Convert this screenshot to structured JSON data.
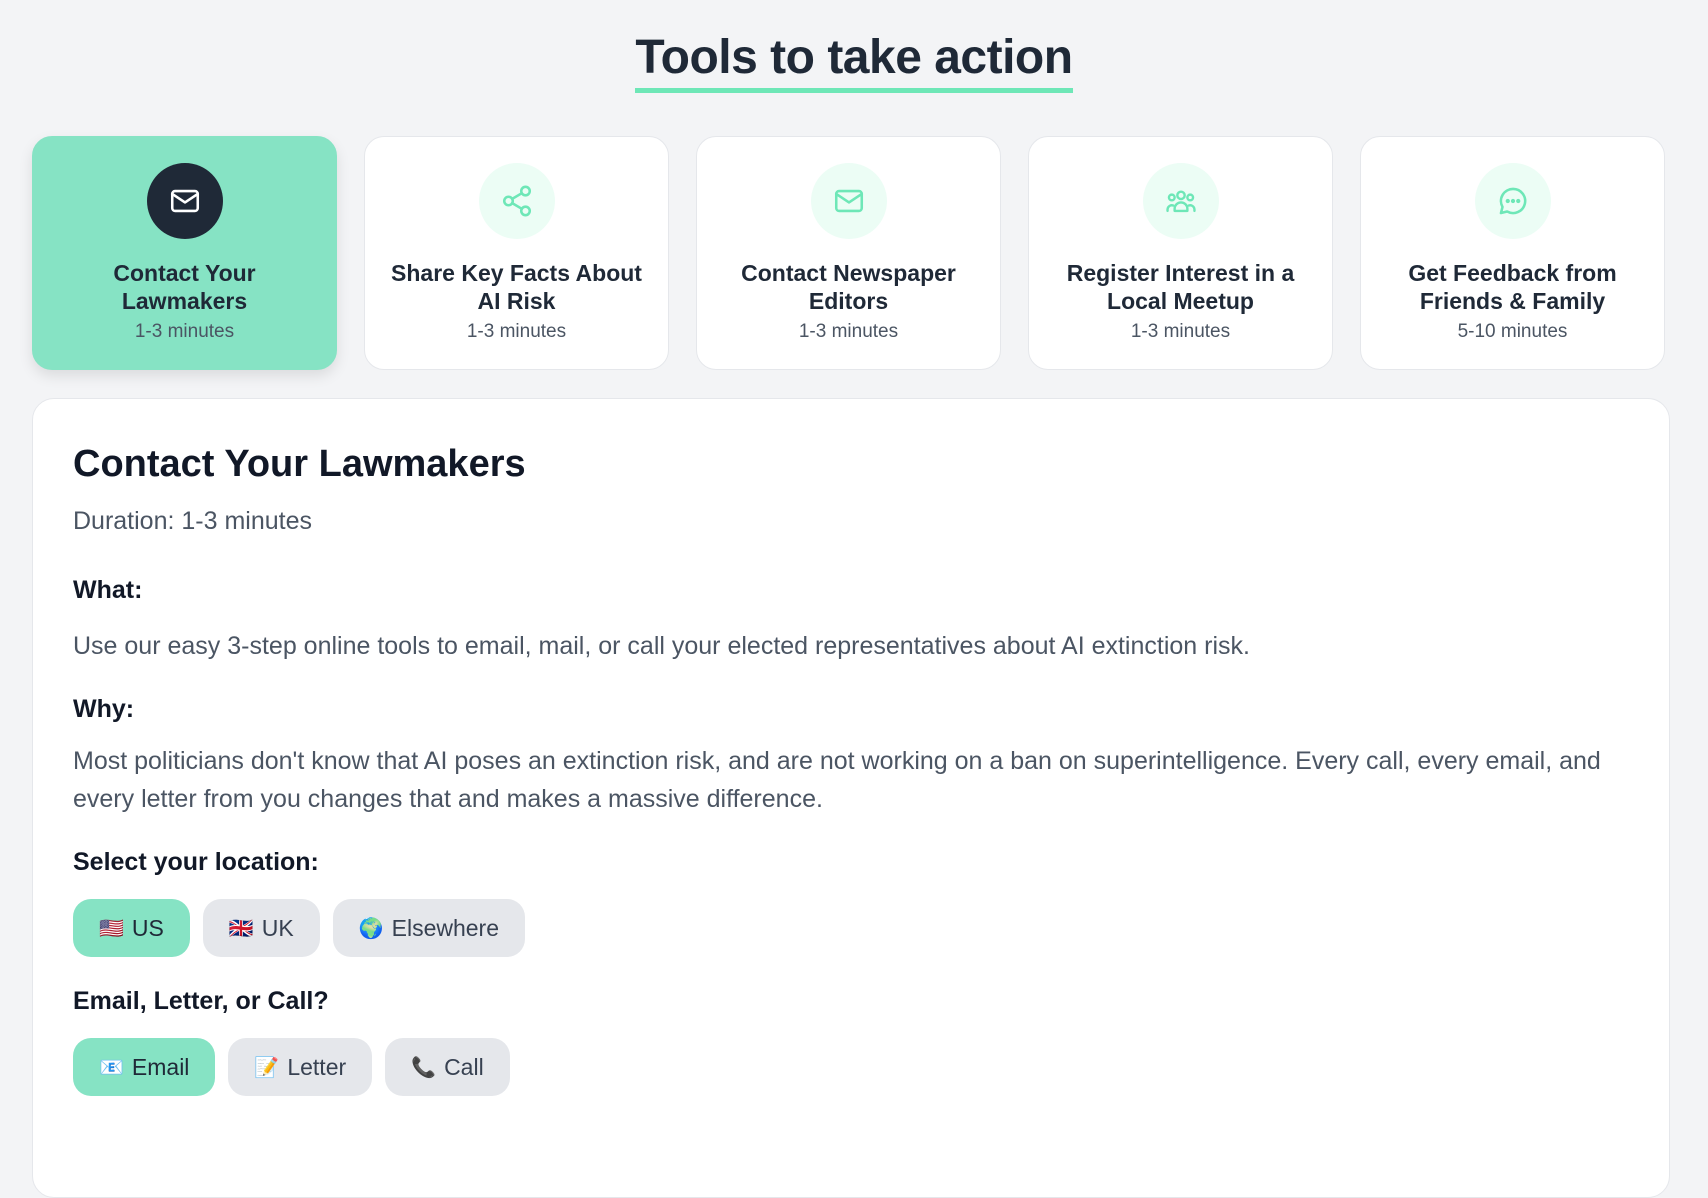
{
  "header": {
    "title": "Tools to take action"
  },
  "cards": [
    {
      "title": "Contact Your Lawmakers",
      "time": "1-3 minutes",
      "icon": "mail-icon"
    },
    {
      "title": "Share Key Facts About AI Risk",
      "time": "1-3 minutes",
      "icon": "share-icon"
    },
    {
      "title": "Contact Newspaper Editors",
      "time": "1-3 minutes",
      "icon": "mail-icon"
    },
    {
      "title": "Register Interest in a Local Meetup",
      "time": "1-3 minutes",
      "icon": "group-icon"
    },
    {
      "title": "Get Feedback from Friends & Family",
      "time": "5-10 minutes",
      "icon": "chat-icon"
    }
  ],
  "panel": {
    "title": "Contact Your Lawmakers",
    "duration": "Duration: 1-3 minutes",
    "what_label": "What:",
    "what_text": "Use our easy 3-step online tools to email, mail, or call your elected representatives about AI extinction risk.",
    "why_label": "Why:",
    "why_text": "Most politicians don't know that AI poses an extinction risk, and are not working on a ban on superintelligence. Every call, every email, and every letter from you changes that and makes a massive difference.",
    "location_label": "Select your location:",
    "locations": [
      {
        "emoji": "🇺🇸",
        "label": "US"
      },
      {
        "emoji": "🇬🇧",
        "label": "UK"
      },
      {
        "emoji": "🌍",
        "label": "Elsewhere"
      }
    ],
    "method_label": "Email, Letter, or Call?",
    "methods": [
      {
        "emoji": "📧",
        "label": "Email"
      },
      {
        "emoji": "📝",
        "label": "Letter"
      },
      {
        "emoji": "📞",
        "label": "Call"
      }
    ]
  },
  "colors": {
    "accent": "#86e3c4",
    "accent_icon": "#6ee7b7",
    "dark": "#1f2937",
    "underline": "#6ee7b7"
  }
}
